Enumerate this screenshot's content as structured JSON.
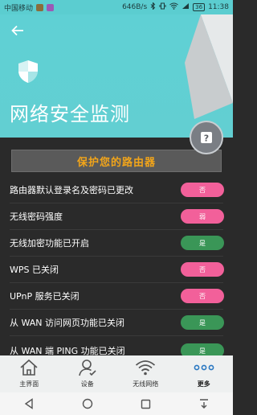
{
  "status_bar": {
    "carrier": "中国移动",
    "speed": "646B/s",
    "battery": "36",
    "time": "11:38"
  },
  "header": {
    "back_icon": "arrow-left-icon",
    "shield_icon": "shield-icon",
    "title": "网络安全监测"
  },
  "help_button": {
    "icon": "question-icon"
  },
  "banner": {
    "text": "保护您的路由器"
  },
  "checks": [
    {
      "label": "路由器默认登录名及密码已更改",
      "status": "否",
      "color": "#f2609a"
    },
    {
      "label": "无线密码强度",
      "status": "弱",
      "color": "#f2609a"
    },
    {
      "label": "无线加密功能已开启",
      "status": "是",
      "color": "#3a9657"
    },
    {
      "label": "WPS 已关闭",
      "status": "否",
      "color": "#f2609a"
    },
    {
      "label": "UPnP 服务已关闭",
      "status": "否",
      "color": "#f2609a"
    },
    {
      "label": "从 WAN 访问网页功能已关闭",
      "status": "是",
      "color": "#3a9657"
    },
    {
      "label": "从 WAN 端 PING 功能已关闭",
      "status": "是",
      "color": "#3a9657"
    }
  ],
  "bottom_nav": [
    {
      "label": "主界面",
      "icon": "home-icon"
    },
    {
      "label": "设备",
      "icon": "device-user-icon"
    },
    {
      "label": "无线网络",
      "icon": "wifi-icon"
    },
    {
      "label": "更多",
      "icon": "more-dots-icon"
    }
  ],
  "colors": {
    "header_bg": "#5fd0d4",
    "accent_orange": "#f2a51a",
    "pill_pink": "#f2609a",
    "pill_green": "#3a9657",
    "body_bg": "#2a2a2a"
  }
}
